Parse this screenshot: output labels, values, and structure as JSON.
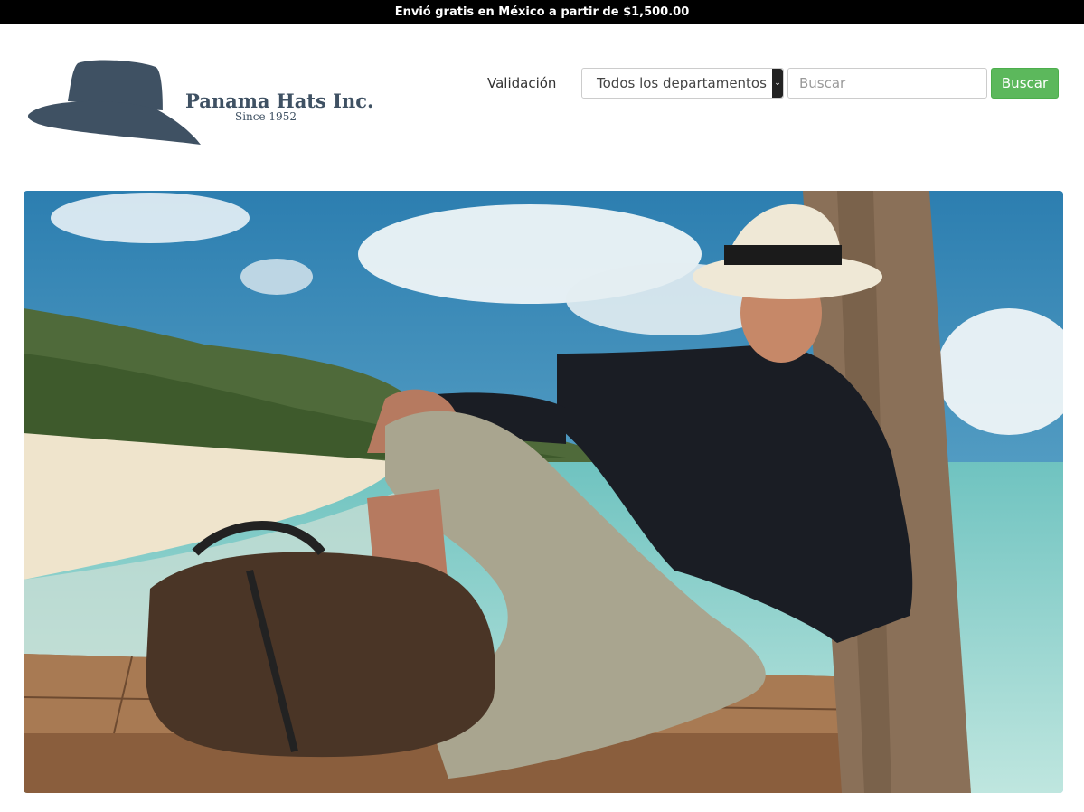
{
  "announcement": "Envió gratis en México a partir de $1,500.00",
  "brand": {
    "name": "Panama Hats Inc.",
    "tagline": "Since 1952",
    "color": "#3f5163"
  },
  "nav": {
    "validation_link": "Validación"
  },
  "search": {
    "department_selected": "Todos los departamentos",
    "placeholder": "Buscar",
    "button_label": "Buscar",
    "button_color": "#5cb85c"
  },
  "hero": {
    "description_icon": "hero-banner-photo"
  }
}
